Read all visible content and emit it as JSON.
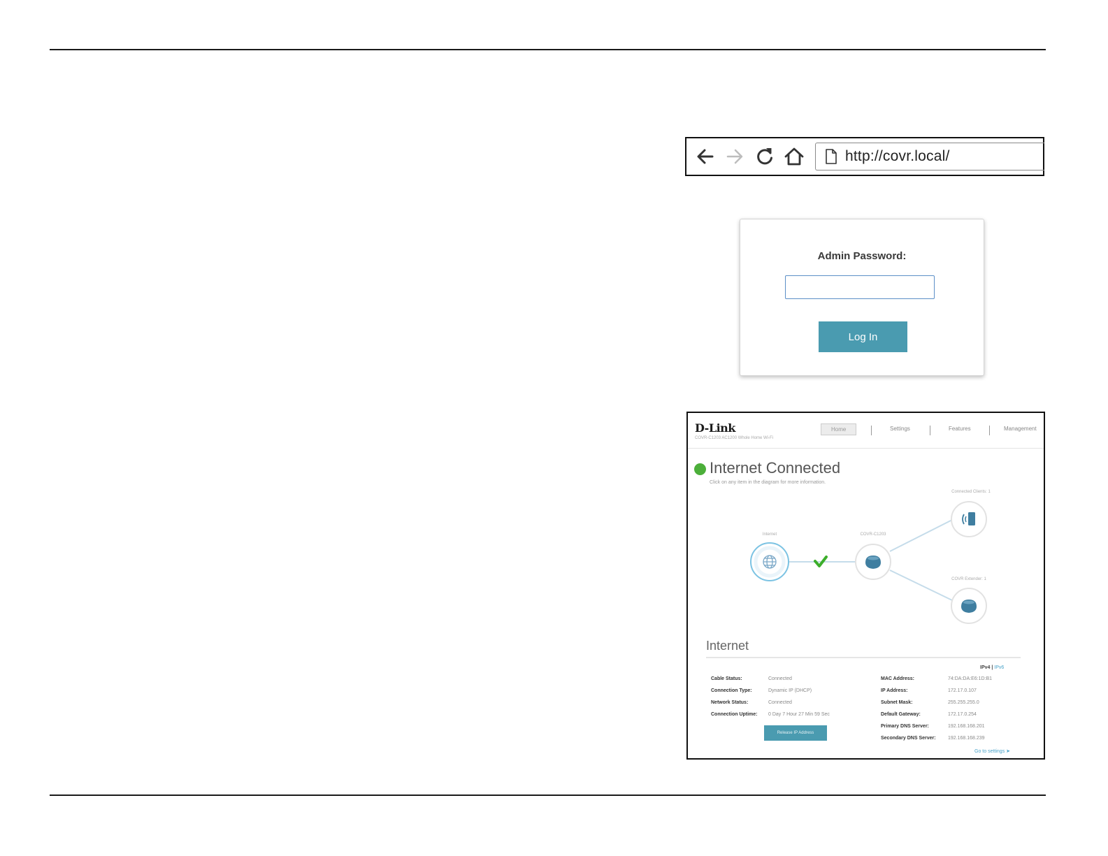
{
  "browser": {
    "url": "http://covr.local/",
    "icons": [
      "back-arrow-icon",
      "forward-arrow-icon",
      "reload-icon",
      "home-icon",
      "page-icon"
    ]
  },
  "login": {
    "label": "Admin Password:",
    "password_value": "",
    "button_label": "Log In"
  },
  "dashboard": {
    "brand": "D-Link",
    "brand_subtitle": "COVR-C1203 AC1200 Whole Home Wi-Fi",
    "menu": [
      "Home",
      "Settings",
      "Features",
      "Management"
    ],
    "status_title": "Internet Connected",
    "status_subtitle": "Click on any item in the diagram for more information.",
    "topology": {
      "internet_label": "Internet",
      "router_label": "COVR-C1203",
      "clients_label": "Connected Clients: 1",
      "extender_label": "COVR Extender: 1"
    },
    "section_title": "Internet",
    "ipv4_label": "IPv4",
    "ipv6_label": "IPv6",
    "left_info": [
      {
        "key": "Cable Status:",
        "value": "Connected"
      },
      {
        "key": "Connection Type:",
        "value": "Dynamic IP (DHCP)"
      },
      {
        "key": "Network Status:",
        "value": "Connected"
      },
      {
        "key": "Connection Uptime:",
        "value": "0 Day 7 Hour 27 Min 59 Sec"
      }
    ],
    "right_info": [
      {
        "key": "MAC Address:",
        "value": "74:DA:DA:E6:1D:B1"
      },
      {
        "key": "IP Address:",
        "value": "172.17.0.107"
      },
      {
        "key": "Subnet Mask:",
        "value": "255.255.255.0"
      },
      {
        "key": "Default Gateway:",
        "value": "172.17.0.254"
      },
      {
        "key": "Primary DNS Server:",
        "value": "192.168.168.201"
      },
      {
        "key": "Secondary DNS Server:",
        "value": "192.168.168.239"
      }
    ],
    "release_button": "Release IP Address",
    "goto_link": "Go to settings",
    "colors": {
      "accent": "#4a9bb0",
      "connected": "#4caf3a",
      "link": "#4aa3c9"
    }
  }
}
